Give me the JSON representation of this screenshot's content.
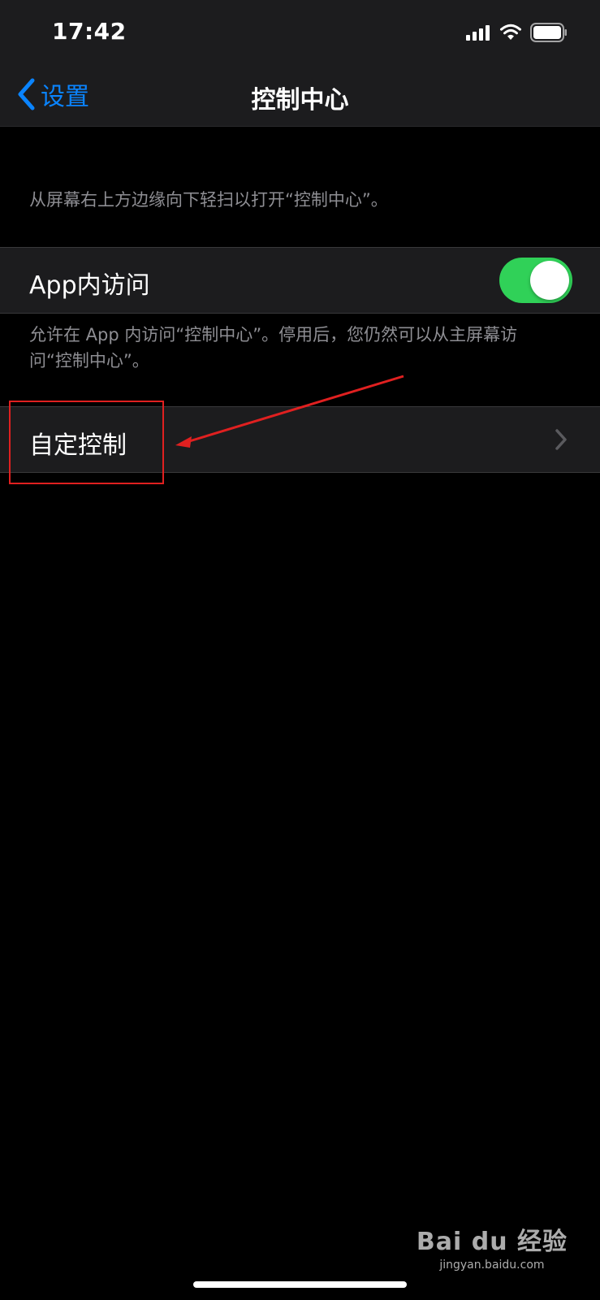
{
  "status_bar": {
    "time": "17:42",
    "icons": [
      "cellular-signal-icon",
      "wifi-icon",
      "battery-icon"
    ]
  },
  "nav": {
    "back_label": "设置",
    "title": "控制中心"
  },
  "intro_text": "从屏幕右上方边缘向下轻扫以打开“控制中心”。",
  "access_row": {
    "label": "App内访问",
    "toggle_on": true
  },
  "access_footer": "允许在 App 内访问“控制中心”。停用后，您仍然可以从主屏幕访问“控制中心”。",
  "customize_row": {
    "label": "自定控制"
  },
  "watermark": {
    "brand": "Bai du 经验",
    "domain": "jingyan.baidu.com"
  },
  "colors": {
    "accent": "#0a84ff",
    "toggle_on": "#30d158",
    "annotation": "#e02020"
  }
}
